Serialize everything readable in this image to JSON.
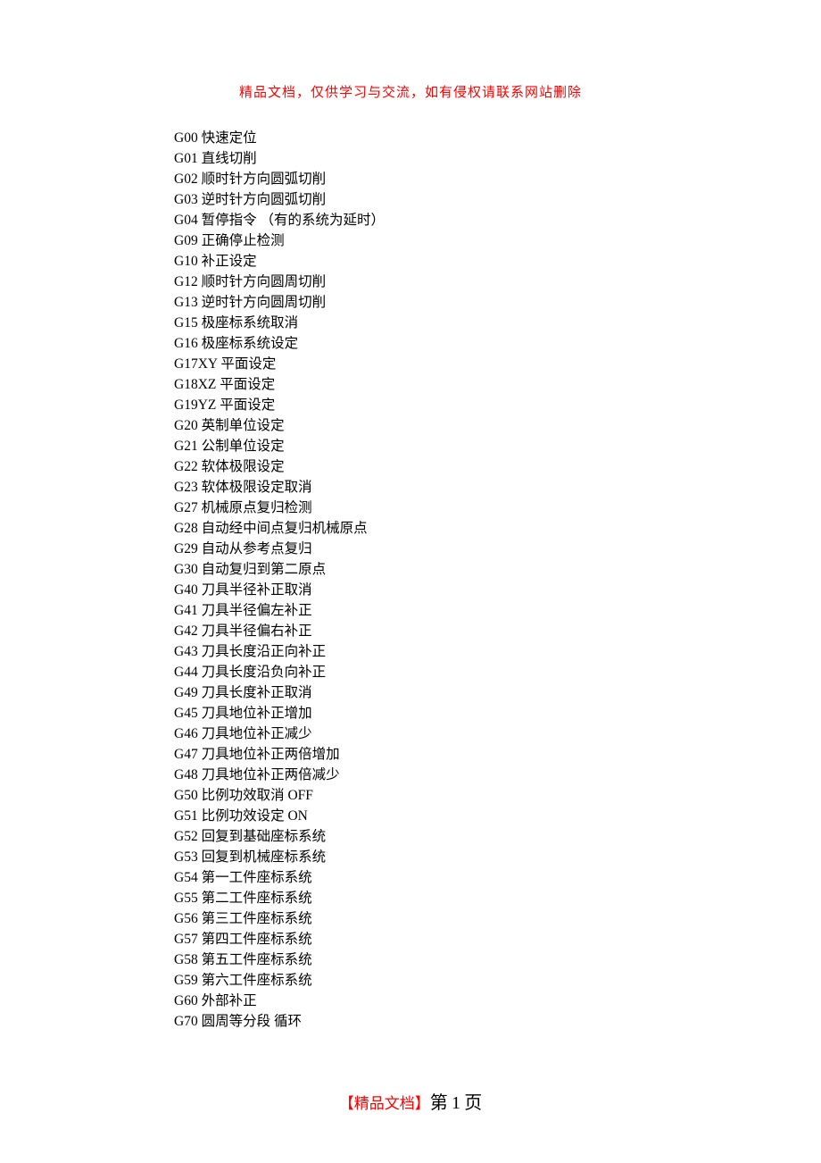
{
  "header": {
    "text": "精品文档，仅供学习与交流，如有侵权请联系网站删除"
  },
  "lines": [
    "G00 快速定位",
    "G01 直线切削",
    "G02 顺时针方向圆弧切削",
    "G03 逆时针方向圆弧切削",
    "G04 暂停指令 （有的系统为延时）",
    "G09 正确停止检测",
    "G10 补正设定",
    "G12 顺时针方向圆周切削",
    "G13 逆时针方向圆周切削",
    "G15 极座标系统取消",
    "G16 极座标系统设定",
    "G17XY 平面设定",
    "G18XZ 平面设定",
    "G19YZ 平面设定",
    "G20 英制单位设定",
    "G21 公制单位设定",
    "G22 软体极限设定",
    "G23 软体极限设定取消",
    "G27 机械原点复归检测",
    "G28 自动经中间点复归机械原点",
    "G29 自动从参考点复归",
    "G30 自动复归到第二原点",
    "G40 刀具半径补正取消",
    "G41 刀具半径偏左补正",
    "G42 刀具半径偏右补正",
    "G43 刀具长度沿正向补正",
    "G44 刀具长度沿负向补正",
    "G49 刀具长度补正取消",
    "G45 刀具地位补正增加",
    "G46 刀具地位补正减少",
    "G47 刀具地位补正两倍增加",
    "G48 刀具地位补正两倍减少",
    "G50 比例功效取消 OFF",
    "G51 比例功效设定 ON",
    "G52 回复到基础座标系统",
    "G53 回复到机械座标系统",
    "G54 第一工件座标系统",
    "G55 第二工件座标系统",
    "G56 第三工件座标系统",
    "G57 第四工件座标系统",
    "G58 第五工件座标系统",
    "G59 第六工件座标系统",
    "G60  外部补正",
    "G70 圆周等分段  循环"
  ],
  "footer": {
    "label": "【精品文档】",
    "page_prefix": "第",
    "page_number": "1",
    "page_suffix": "页"
  }
}
